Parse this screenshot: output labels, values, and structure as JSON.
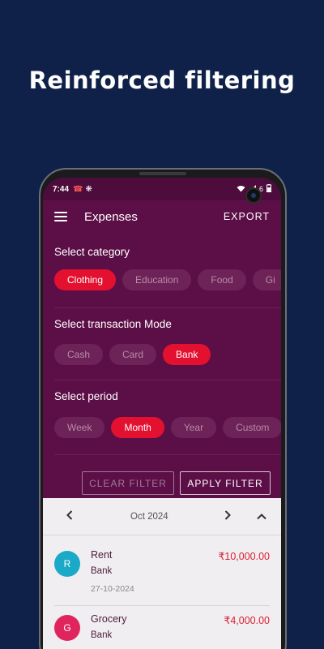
{
  "headline": "Reinforced filtering",
  "status_bar": {
    "time": "7:44",
    "left_icons": [
      "missed-call-icon",
      "fan-icon"
    ],
    "right_icons": [
      "wifi-icon",
      "signal-icon",
      "battery-icon"
    ],
    "battery_text": "6"
  },
  "appbar": {
    "title": "Expenses",
    "export_label": "EXPORT"
  },
  "category": {
    "title": "Select category",
    "chips": [
      "Clothing",
      "Education",
      "Food",
      "Gi"
    ],
    "selected": "Clothing"
  },
  "mode": {
    "title": "Select transaction Mode",
    "chips": [
      "Cash",
      "Card",
      "Bank"
    ],
    "selected": "Bank"
  },
  "period": {
    "title": "Select period",
    "chips": [
      "Week",
      "Month",
      "Year",
      "Custom"
    ],
    "selected": "Month"
  },
  "filter_buttons": {
    "clear_label": "CLEAR FILTER",
    "apply_label": "APPLY FILTER"
  },
  "month_nav": {
    "label": "Oct 2024",
    "prev_icon": "chevron-left-icon",
    "next_icon": "chevron-right-icon",
    "collapse_icon": "chevron-up-icon"
  },
  "transactions": [
    {
      "initial": "R",
      "name": "Rent",
      "mode": "Bank",
      "date": "27-10-2024",
      "amount": "₹10,000.00",
      "color": "#1aa9c7"
    },
    {
      "initial": "G",
      "name": "Grocery",
      "mode": "Bank",
      "date": "",
      "amount": "₹4,000.00",
      "color": "#e0245e"
    }
  ],
  "colors": {
    "background": "#0f2149",
    "screen": "#5c0f47",
    "accent": "#e3102f",
    "list_background": "#f1eef1"
  }
}
